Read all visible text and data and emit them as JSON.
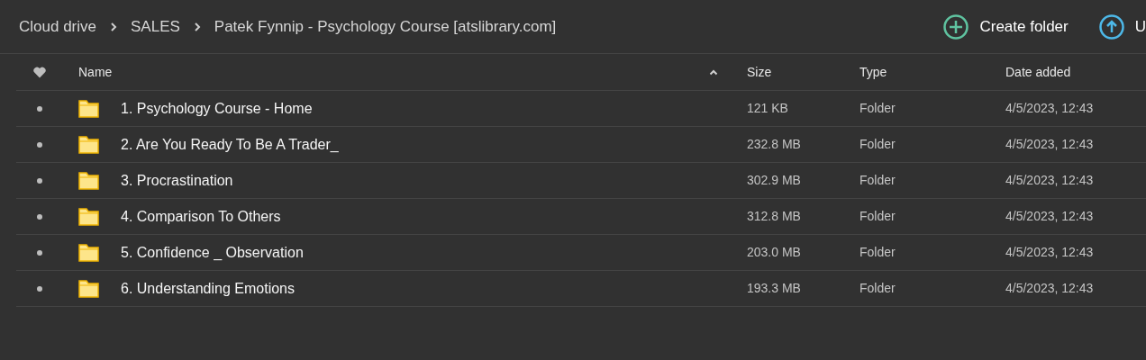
{
  "breadcrumb": [
    "Cloud drive",
    "SALES",
    "Patek Fynnip - Psychology Course [atslibrary.com]"
  ],
  "actions": [
    {
      "kind": "create",
      "label": "Create folder"
    },
    {
      "kind": "upload",
      "label": "U"
    }
  ],
  "table": {
    "columns": [
      "Name",
      "Size",
      "Type",
      "Date added"
    ],
    "rows": [
      {
        "name": "1. Psychology Course - Home",
        "size": "121 KB",
        "type": "Folder",
        "date": "4/5/2023, 12:43"
      },
      {
        "name": "2. Are You Ready To Be A Trader_",
        "size": "232.8 MB",
        "type": "Folder",
        "date": "4/5/2023, 12:43"
      },
      {
        "name": "3. Procrastination",
        "size": "302.9 MB",
        "type": "Folder",
        "date": "4/5/2023, 12:43"
      },
      {
        "name": "4. Comparison To Others",
        "size": "312.8 MB",
        "type": "Folder",
        "date": "4/5/2023, 12:43"
      },
      {
        "name": "5. Confidence _ Observation",
        "size": "203.0 MB",
        "type": "Folder",
        "date": "4/5/2023, 12:43"
      },
      {
        "name": "6. Understanding Emotions",
        "size": "193.3 MB",
        "type": "Folder",
        "date": "4/5/2023, 12:43"
      }
    ]
  }
}
